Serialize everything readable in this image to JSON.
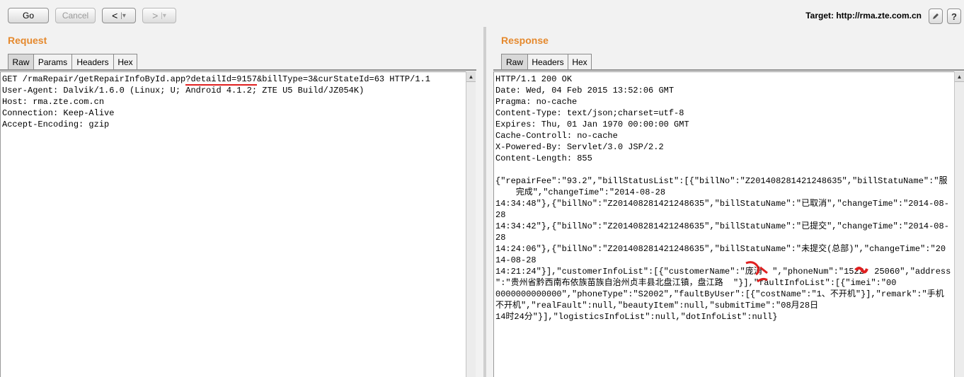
{
  "toolbar": {
    "go_label": "Go",
    "cancel_label": "Cancel",
    "back_label": "<",
    "forward_label": ">",
    "target_label": "Target: http://rma.zte.com.cn",
    "edit_icon": "pencil-icon",
    "help_label": "?"
  },
  "request": {
    "title": "Request",
    "tabs": [
      "Raw",
      "Params",
      "Headers",
      "Hex"
    ],
    "active_tab": "Raw",
    "line1_start": "GET /rmaRepair/getRepairInfoById.app",
    "line1_highlight": "?detailId=9157",
    "line1_end": "&billType=3&curStateId=63 HTTP/1.1",
    "headers": "User-Agent: Dalvik/1.6.0 (Linux; U; Android 4.1.2; ZTE U5 Build/JZ054K)\nHost: rma.zte.com.cn\nConnection: Keep-Alive\nAccept-Encoding: gzip"
  },
  "response": {
    "title": "Response",
    "tabs": [
      "Raw",
      "Headers",
      "Hex"
    ],
    "active_tab": "Raw",
    "headers": "HTTP/1.1 200 OK\nDate: Wed, 04 Feb 2015 13:52:06 GMT\nPragma: no-cache\nContent-Type: text/json;charset=utf-8\nExpires: Thu, 01 Jan 1970 00:00:00 GMT\nCache-Controll: no-cache\nX-Powered-By: Servlet/3.0 JSP/2.2\nContent-Length: 855",
    "body": "{\"repairFee\":\"93.2\",\"billStatusList\":[{\"billNo\":\"Z201408281421248635\",\"billStatuName\":\"服\n    完成\",\"changeTime\":\"2014-08-28\n14:34:48\"},{\"billNo\":\"Z201408281421248635\",\"billStatuName\":\"已取消\",\"changeTime\":\"2014-08-\n28\n14:34:42\"},{\"billNo\":\"Z201408281421248635\",\"billStatuName\":\"已提交\",\"changeTime\":\"2014-08-\n28\n14:24:06\"},{\"billNo\":\"Z201408281421248635\",\"billStatuName\":\"未提交(总部)\",\"changeTime\":\"20\n14-08-28\n14:21:24\"}],\"customerInfoList\":[{\"customerName\":\"庞消  \",\"phoneNum\":\"1522  25060\",\"address\n\":\"贵州省黔西南布依族苗族自治州贞丰县北盘江镇，盘江路  \"}],\"faultInfoList\":[{\"imei\":\"00\n0000000000000\",\"phoneType\":\"S2002\",\"faultByUser\":[{\"costName\":\"1、不开机\"}],\"remark\":\"手机\n不开机\",\"realFault\":null,\"beautyItem\":null,\"submitTime\":\"08月28日\n14时24分\"}],\"logisticsInfoList\":null,\"dotInfoList\":null}"
  }
}
